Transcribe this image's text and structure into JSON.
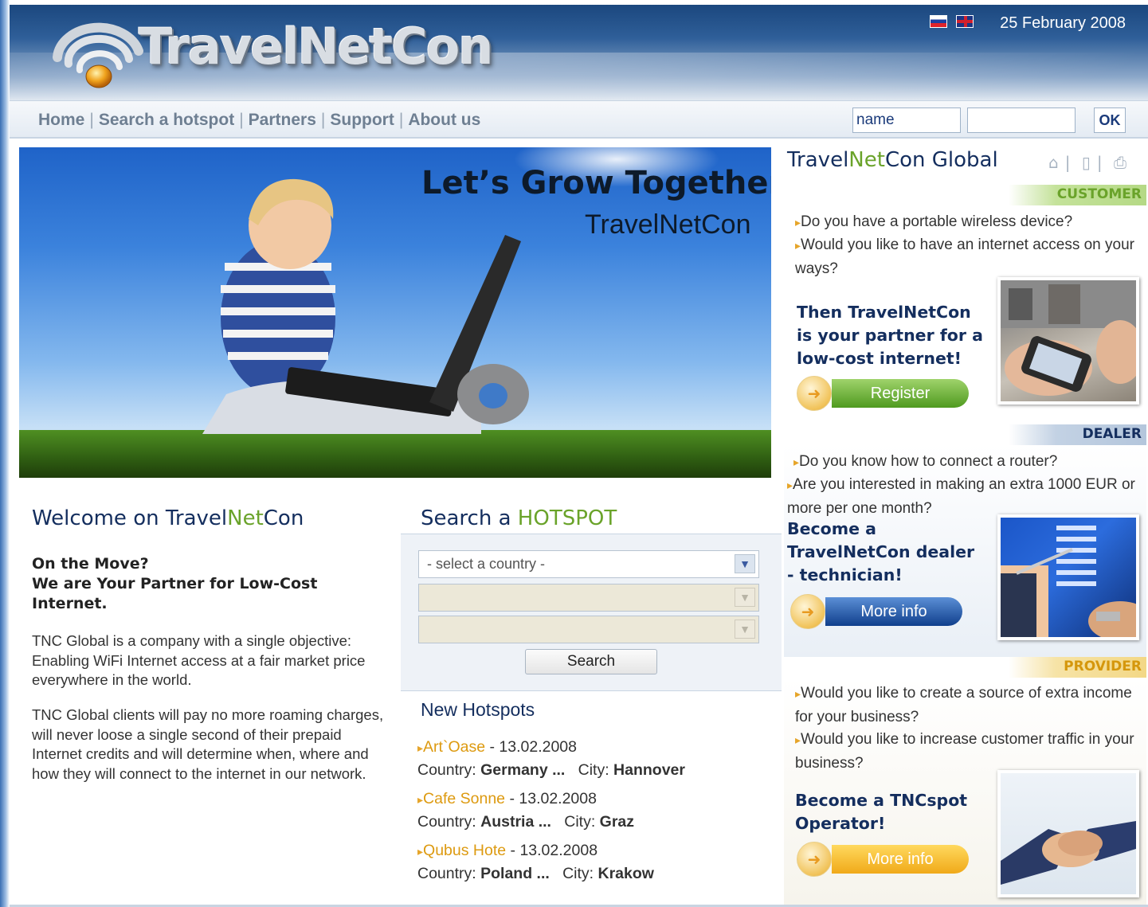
{
  "header": {
    "logo_text": "TravelNetCon",
    "date": "25 February 2008"
  },
  "nav": {
    "items": [
      "Home",
      "Search a hotspot",
      "Partners",
      "Support",
      "About us"
    ]
  },
  "login": {
    "name_value": "name",
    "password_value": "",
    "ok_label": "OK"
  },
  "hero": {
    "title": "Let’s Grow Together",
    "subtitle": "TravelNetCon"
  },
  "welcome": {
    "title_prefix": "Welcome on Travel",
    "title_green": "Net",
    "title_suffix": "Con",
    "lead": "On the Move?\nWe are Your Partner for Low-Cost Internet.",
    "p1": "TNC Global is a company with a single objective: Enabling WiFi Internet access at a fair market price everywhere in the world.",
    "p2": "TNC Global clients will pay no more roaming charges, will never loose a single second of their prepaid Internet credits and will determine when, where and how they will connect to the internet in our network."
  },
  "search": {
    "title_prefix": "Search a ",
    "title_highlight": "HOTSPOT",
    "country_placeholder": "- select a country -",
    "search_label": "Search"
  },
  "new_hotspots": {
    "title": "New Hotspots",
    "country_label": "Country:",
    "city_label": "City:",
    "items": [
      {
        "name": "Art`Oase",
        "date": "13.02.2008",
        "country": "Germany ...",
        "city": "Hannover"
      },
      {
        "name": "Cafe Sonne",
        "date": "13.02.2008",
        "country": "Austria ...",
        "city": "Graz"
      },
      {
        "name": "Qubus Hote",
        "date": "13.02.2008",
        "country": "Poland ...",
        "city": "Krakow"
      }
    ]
  },
  "right": {
    "title_prefix": "Travel",
    "title_green": "Net",
    "title_suffix": "Con Global",
    "icons": [
      "home-icon",
      "bookmark-icon",
      "print-icon"
    ],
    "customer": {
      "label": "CUSTOMER",
      "q1": "Do you have a portable wireless device?",
      "q2": "Would you like to have an internet access  on your ways?",
      "cta": "Then TravelNetCon is your partner for a low-cost internet!",
      "button": "Register"
    },
    "dealer": {
      "label": "DEALER",
      "q1": "Do you know how to connect a router?",
      "q2": "Are you interested in making an extra 1000 EUR or more per one month?",
      "cta": "Become a TravelNetCon dealer - technician!",
      "button": "More info"
    },
    "provider": {
      "label": "PROVIDER",
      "q1": "Would you like to create a source of extra income for your business?",
      "q2": "Would you like to increase customer traffic  in your business?",
      "cta": "Become a TNCspot Operator!",
      "button": "More info"
    }
  },
  "colors": {
    "brand_navy": "#142e5e",
    "brand_green": "#6aa32a",
    "accent_orange": "#dd9a10"
  }
}
